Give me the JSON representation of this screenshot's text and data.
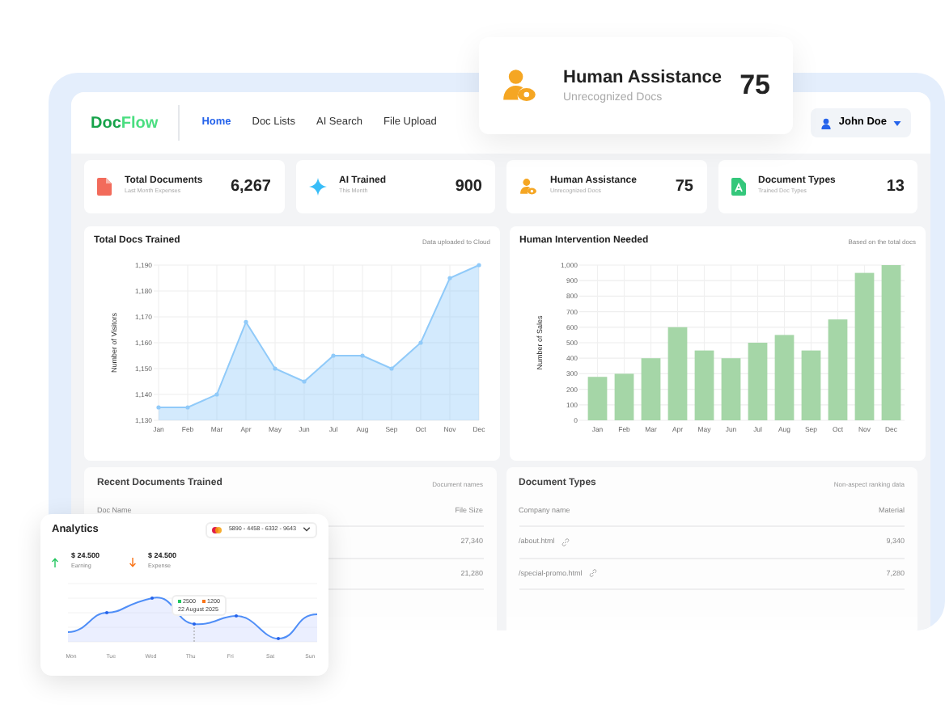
{
  "floating_card": {
    "title": "Human Assistance",
    "subtitle": "Unrecognized Docs",
    "value": "75"
  },
  "header": {
    "logo": [
      {
        "text": "Doc",
        "color": "#16a34a"
      },
      {
        "text": "Flow",
        "color": "#4ade80"
      }
    ],
    "nav": [
      {
        "label": "Home",
        "selected": true
      },
      {
        "label": "Doc Lists",
        "selected": false
      },
      {
        "label": "AI Search",
        "selected": false
      },
      {
        "label": "File Upload",
        "selected": false
      }
    ],
    "user": "John Doe"
  },
  "stats": [
    {
      "kind": "file",
      "title": "Total Documents",
      "subtitle": "Last Month Expenses",
      "value": "6,267"
    },
    {
      "kind": "sparkle",
      "title": "AI Trained",
      "subtitle": "This Month",
      "value": "900"
    },
    {
      "kind": "person",
      "title": "Human Assistance",
      "subtitle": "Unrecognized Docs",
      "value": "75"
    },
    {
      "kind": "doc",
      "title": "Document Types",
      "subtitle": "Trained Doc Types",
      "value": "13"
    }
  ],
  "charts": [
    {
      "note": "Data uploaded to Cloud",
      "chart_data": {
        "type": "area",
        "title": "Total Docs Trained",
        "ylabel": "Number of Visitors",
        "categories": [
          "Jan",
          "Feb",
          "Mar",
          "Apr",
          "May",
          "Jun",
          "Jul",
          "Aug",
          "Sep",
          "Oct",
          "Nov",
          "Dec"
        ],
        "grid": true,
        "series": [
          {
            "color": "#90caf9",
            "values": [
              1135,
              1135,
              1140,
              1168,
              1150,
              1145,
              1155,
              1155,
              1150,
              1160,
              1185,
              1190
            ]
          }
        ],
        "ylim": [
          1130,
          1190
        ],
        "yticks": [
          {
            "value": 1130,
            "label": "1,130"
          },
          {
            "value": 1140,
            "label": "1,140"
          },
          {
            "value": 1150,
            "label": "1,150"
          },
          {
            "value": 1160,
            "label": "1,160"
          },
          {
            "value": 1170,
            "label": "1,170"
          },
          {
            "value": 1180,
            "label": "1,180"
          },
          {
            "value": 1190,
            "label": "1,190"
          }
        ]
      }
    },
    {
      "note": "Based on the total docs",
      "chart_data": {
        "type": "bar",
        "title": "Human Intervention Needed",
        "ylabel": "Number of Sales",
        "categories": [
          "Jan",
          "Feb",
          "Mar",
          "Apr",
          "May",
          "Jun",
          "Jul",
          "Aug",
          "Sep",
          "Oct",
          "Nov",
          "Dec"
        ],
        "grid": true,
        "series": [
          {
            "color": "#a5d6a7",
            "values": [
              280,
              300,
              400,
              600,
              450,
              400,
              500,
              550,
              450,
              650,
              950,
              1000
            ]
          }
        ],
        "ylim": [
          0,
          1000
        ],
        "yticks": [
          {
            "value": 0,
            "label": "0"
          },
          {
            "value": 100,
            "label": "100"
          },
          {
            "value": 200,
            "label": "200"
          },
          {
            "value": 300,
            "label": "300"
          },
          {
            "value": 400,
            "label": "400"
          },
          {
            "value": 500,
            "label": "500"
          },
          {
            "value": 600,
            "label": "600"
          },
          {
            "value": 700,
            "label": "700"
          },
          {
            "value": 800,
            "label": "800"
          },
          {
            "value": 900,
            "label": "900"
          },
          {
            "value": 1000,
            "label": "1,000"
          }
        ]
      }
    }
  ],
  "tables": [
    {
      "title": "Recent Documents Trained",
      "note": "Document names",
      "columns": [
        "Doc Name",
        "File Size"
      ],
      "rows": [
        {
          "cells": [
            "",
            "27,340"
          ]
        },
        {
          "cells": [
            "",
            "21,280"
          ]
        }
      ]
    },
    {
      "title": "Document Types",
      "note": "Non-aspect ranking data",
      "columns": [
        "Company name",
        "Material"
      ],
      "rows": [
        {
          "cells": [
            "/about.html",
            "9,340"
          ]
        },
        {
          "cells": [
            "/special-promo.html",
            "7,280"
          ]
        }
      ]
    }
  ],
  "analytics": {
    "title": "Analytics",
    "card_number": "5890 - 4458 - 6332 - 9643",
    "figures": [
      {
        "amount": "$ 24.500",
        "label": "Earning",
        "kind": "up"
      },
      {
        "amount": "$ 24.500",
        "label": "Expense",
        "kind": "down"
      }
    ],
    "tooltip": {
      "items": [
        {
          "value": "2500",
          "color": "#22c55e"
        },
        {
          "value": "1200",
          "color": "#f97316"
        }
      ],
      "date": "22 August 2025"
    },
    "x_labels": [
      "Mon",
      "Tue",
      "Wed",
      "Thu",
      "Fri",
      "Sat",
      "Sun"
    ]
  }
}
